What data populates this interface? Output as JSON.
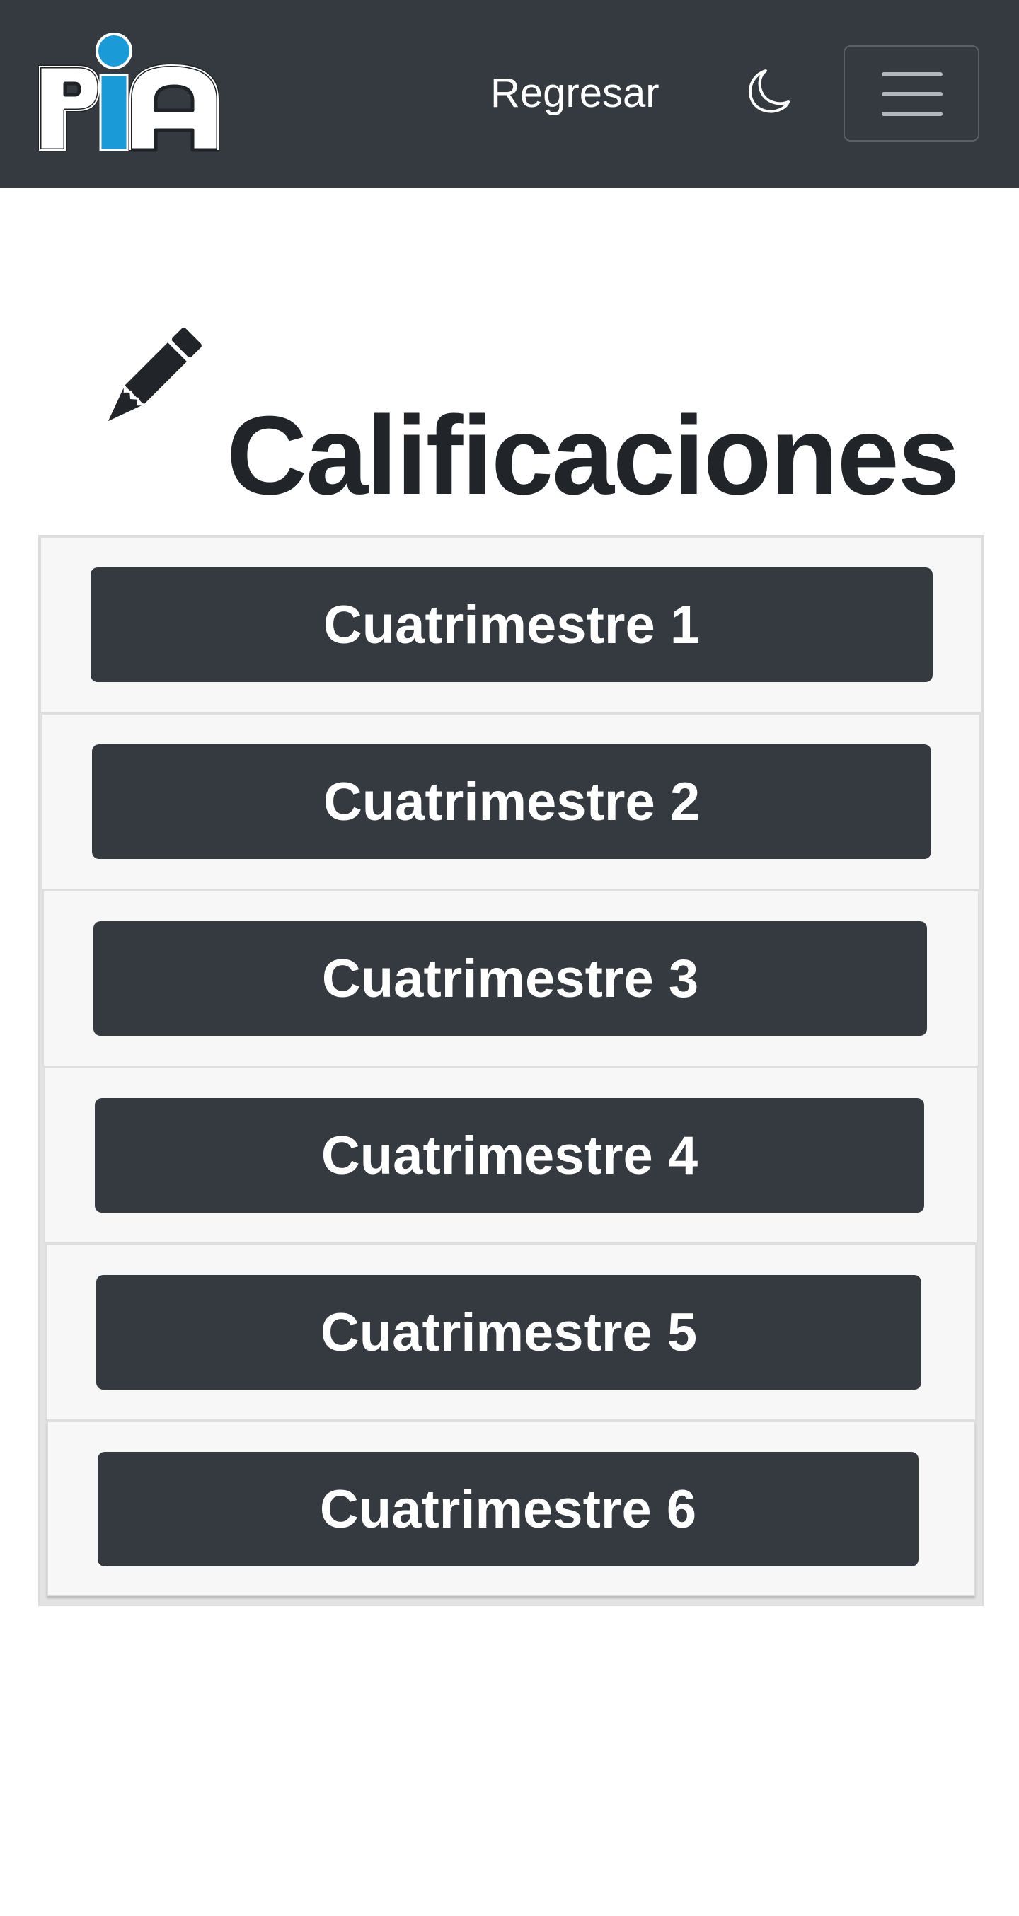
{
  "app": {
    "logo_text": "PIA",
    "logo_icon": "pia-logo",
    "colors": {
      "navbar": "#343a40",
      "logo_accent": "#1a9ad6",
      "button": "#343a40",
      "card": "#f7f7f7"
    }
  },
  "navbar": {
    "back_label": "Regresar",
    "theme_icon": "moon-icon",
    "menu_icon": "hamburger-icon"
  },
  "main": {
    "title_icon": "pencil-icon",
    "title": "Calificaciones",
    "semesters": [
      {
        "label": "Cuatrimestre 1"
      },
      {
        "label": "Cuatrimestre 2"
      },
      {
        "label": "Cuatrimestre 3"
      },
      {
        "label": "Cuatrimestre 4"
      },
      {
        "label": "Cuatrimestre 5"
      },
      {
        "label": "Cuatrimestre 6"
      }
    ]
  }
}
